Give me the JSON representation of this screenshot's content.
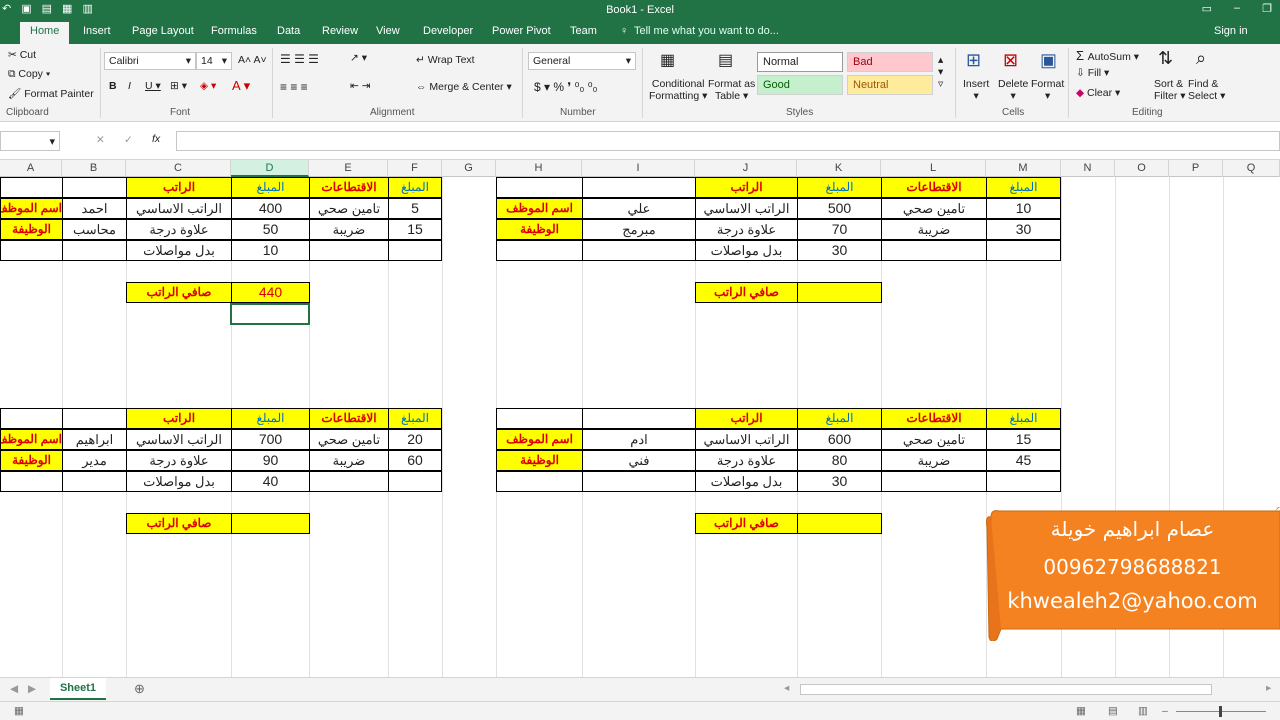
{
  "window": {
    "title": "Book1 - Excel",
    "signin": "Sign in"
  },
  "tabs": [
    "Home",
    "Insert",
    "Page Layout",
    "Formulas",
    "Data",
    "Review",
    "View",
    "Developer",
    "Power Pivot",
    "Team"
  ],
  "tell_me": "Tell me what you want to do...",
  "clipboard": {
    "cut": "Cut",
    "copy": "Copy",
    "painter": "Format Painter",
    "label": "Clipboard"
  },
  "font": {
    "name": "Calibri",
    "size": "14",
    "label": "Font"
  },
  "alignment": {
    "wrap": "Wrap Text",
    "merge": "Merge & Center",
    "label": "Alignment"
  },
  "number": {
    "format": "General",
    "label": "Number"
  },
  "styles": {
    "cond1": "Conditional",
    "cond2": "Formatting",
    "fmt1": "Format as",
    "fmt2": "Table",
    "normal": "Normal",
    "bad": "Bad",
    "good": "Good",
    "neutral": "Neutral",
    "label": "Styles"
  },
  "cells": {
    "insert": "Insert",
    "delete": "Delete",
    "format": "Format",
    "label": "Cells"
  },
  "editing": {
    "autosum": "AutoSum",
    "fill": "Fill",
    "clear": "Clear",
    "sort1": "Sort &",
    "sort2": "Filter",
    "find1": "Find &",
    "find2": "Select",
    "label": "Editing"
  },
  "columns": [
    "A",
    "B",
    "C",
    "D",
    "E",
    "F",
    "G",
    "H",
    "I",
    "J",
    "K",
    "L",
    "M",
    "N",
    "O",
    "P",
    "Q"
  ],
  "labels": {
    "salary": "الراتب",
    "amount": "المبلغ",
    "deductions": "الاقتطاعات",
    "basic": "الراتب الاساسي",
    "health": "تامين صحي",
    "bonus": "علاوة درجة",
    "tax": "ضريبة",
    "transport": "بدل مواصلات",
    "emp_name": "اسم الموظف",
    "job": "الوظيفة",
    "net": "صافي الراتب"
  },
  "t1": {
    "name": "احمد",
    "job": "محاسب",
    "basic": "400",
    "bonus": "50",
    "transport": "10",
    "health": "5",
    "tax": "15",
    "net": "440"
  },
  "t2": {
    "name": "علي",
    "job": "مبرمج",
    "basic": "500",
    "bonus": "70",
    "transport": "30",
    "health": "10",
    "tax": "30",
    "net": ""
  },
  "t3": {
    "name": "ابراهيم",
    "job": "مدير",
    "basic": "700",
    "bonus": "90",
    "transport": "40",
    "health": "20",
    "tax": "60",
    "net": ""
  },
  "t4": {
    "name": "ادم",
    "job": "فني",
    "basic": "600",
    "bonus": "80",
    "transport": "30",
    "health": "15",
    "tax": "45",
    "net": ""
  },
  "banner": {
    "name": "عصام ابراهيم خويلة",
    "phone": "00962798688821",
    "email": "khwealeh2@yahoo.com"
  },
  "sheet": {
    "tab": "Sheet1"
  }
}
